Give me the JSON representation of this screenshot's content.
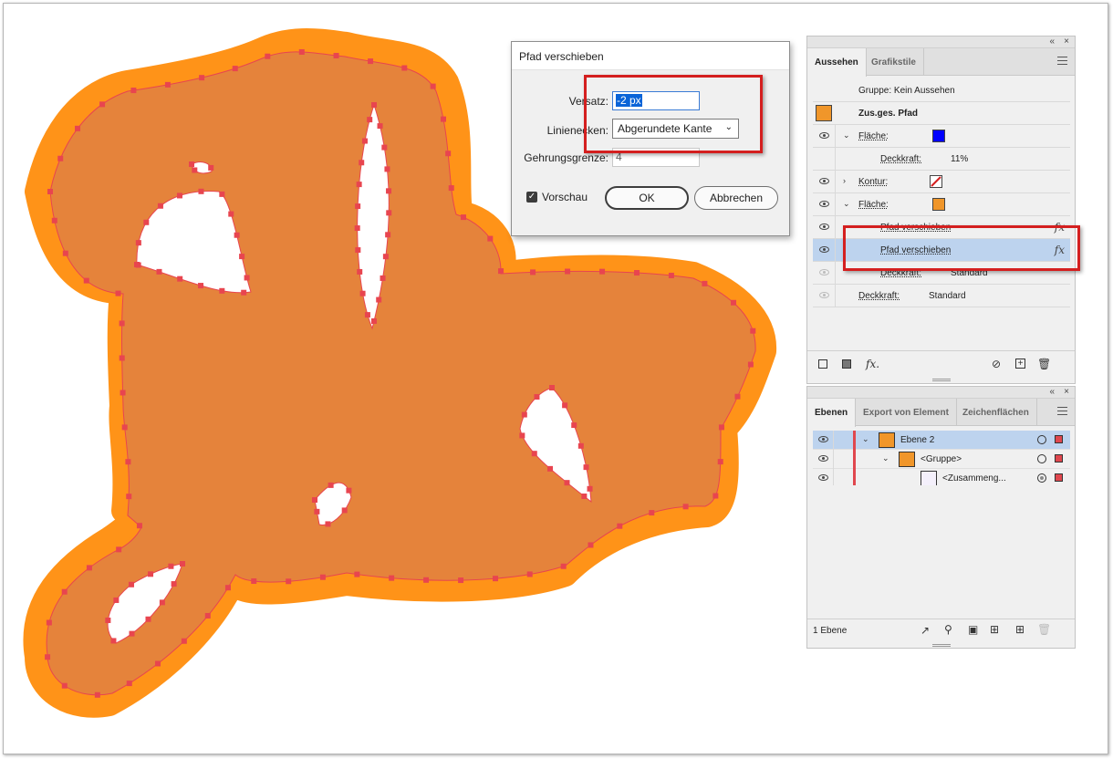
{
  "dialog": {
    "title": "Pfad verschieben",
    "offset_label": "Versatz:",
    "offset_value": "-2 px",
    "joins_label": "Linienecken:",
    "joins_value": "Abgerundete Kante",
    "miter_label": "Gehrungsgrenze:",
    "miter_value": "4",
    "preview_label": "Vorschau",
    "preview_checked": true,
    "ok_label": "OK",
    "cancel_label": "Abbrechen"
  },
  "appearance": {
    "tabs": [
      "Aussehen",
      "Grafikstile"
    ],
    "rows": {
      "group": "Gruppe: Kein Aussehen",
      "compound": "Zus.ges. Pfad",
      "fill1": "Fläche:",
      "fill1_color": "#0000ff",
      "opacity_label": "Deckkraft:",
      "opacity_value": "11%",
      "stroke": "Kontur:",
      "fill2": "Fläche:",
      "fill2_color": "#f0962a",
      "effect1": "Pfad verschieben",
      "effect2": "Pfad verschieben",
      "opacity2_label": "Deckkraft:",
      "opacity2_value": "Standard",
      "opacity3_label": "Deckkraft:",
      "opacity3_value": "Standard"
    }
  },
  "layers": {
    "tabs": [
      "Ebenen",
      "Export von Element",
      "Zeichenflächen"
    ],
    "rows": [
      "Ebene 2",
      "<Gruppe>",
      "<Zusammeng..."
    ],
    "status": "1 Ebene"
  },
  "colors": {
    "outer_fill": "#ff9318",
    "inner_fill": "#e5833b",
    "anchor": "#e8454f",
    "highlight": "#d41f1f"
  }
}
